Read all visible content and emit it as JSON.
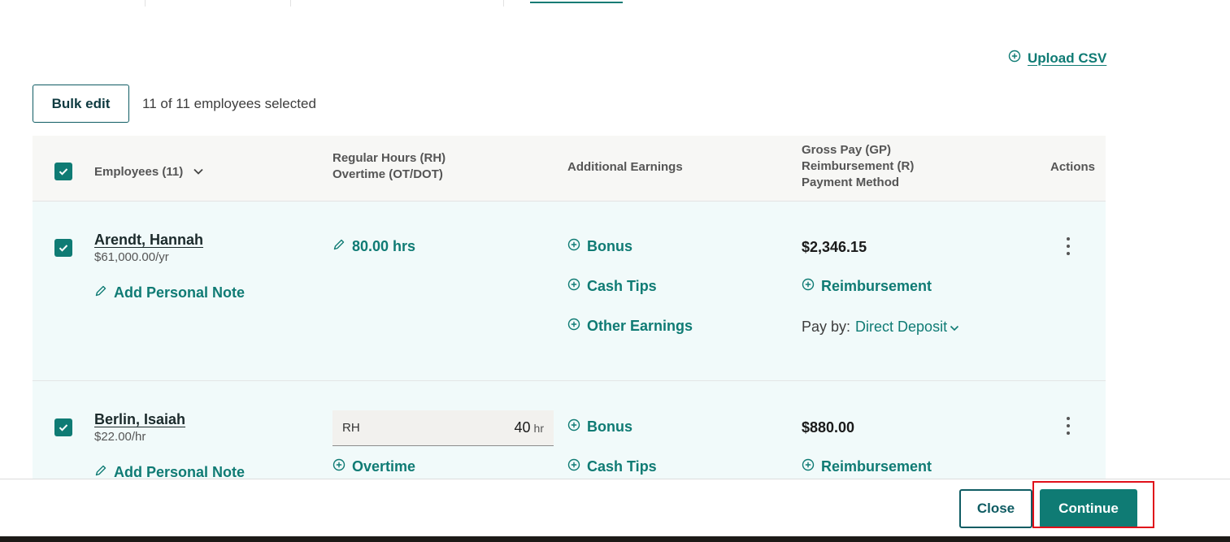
{
  "upload_csv": {
    "label": "Upload CSV",
    "icon": "plus-circle-icon"
  },
  "bulk_edit": {
    "label": "Bulk edit"
  },
  "selection": {
    "summary": "11 of 11 employees selected"
  },
  "table": {
    "headers": {
      "employees": "Employees (11)",
      "hours_line1": "Regular Hours (RH)",
      "hours_line2": "Overtime (OT/DOT)",
      "additional_earnings": "Additional Earnings",
      "pay_line1": "Gross Pay (GP)",
      "pay_line2": "Reimbursement (R)",
      "pay_line3": "Payment Method",
      "actions": "Actions"
    },
    "rows": [
      {
        "name": "Arendt, Hannah",
        "rate": "$61,000.00/yr",
        "note_label": "Add Personal Note",
        "hours": "80.00 hrs",
        "earnings": [
          "Bonus",
          "Cash Tips",
          "Other Earnings"
        ],
        "gross_pay": "$2,346.15",
        "reimbursement_label": "Reimbursement",
        "pay_by_label": "Pay by:",
        "pay_method": "Direct Deposit"
      },
      {
        "name": "Berlin, Isaiah",
        "rate": "$22.00/hr",
        "note_label": "Add Personal Note",
        "rh_label": "RH",
        "rh_value": "40",
        "rh_unit": "hr",
        "overtime_label": "Overtime",
        "earnings": [
          "Bonus",
          "Cash Tips"
        ],
        "gross_pay": "$880.00",
        "reimbursement_label": "Reimbursement"
      }
    ]
  },
  "footer": {
    "close_label": "Close",
    "continue_label": "Continue"
  },
  "colors": {
    "accent": "#0f7b74",
    "row_bg": "#f1fafa",
    "highlight": "#e0101a"
  }
}
